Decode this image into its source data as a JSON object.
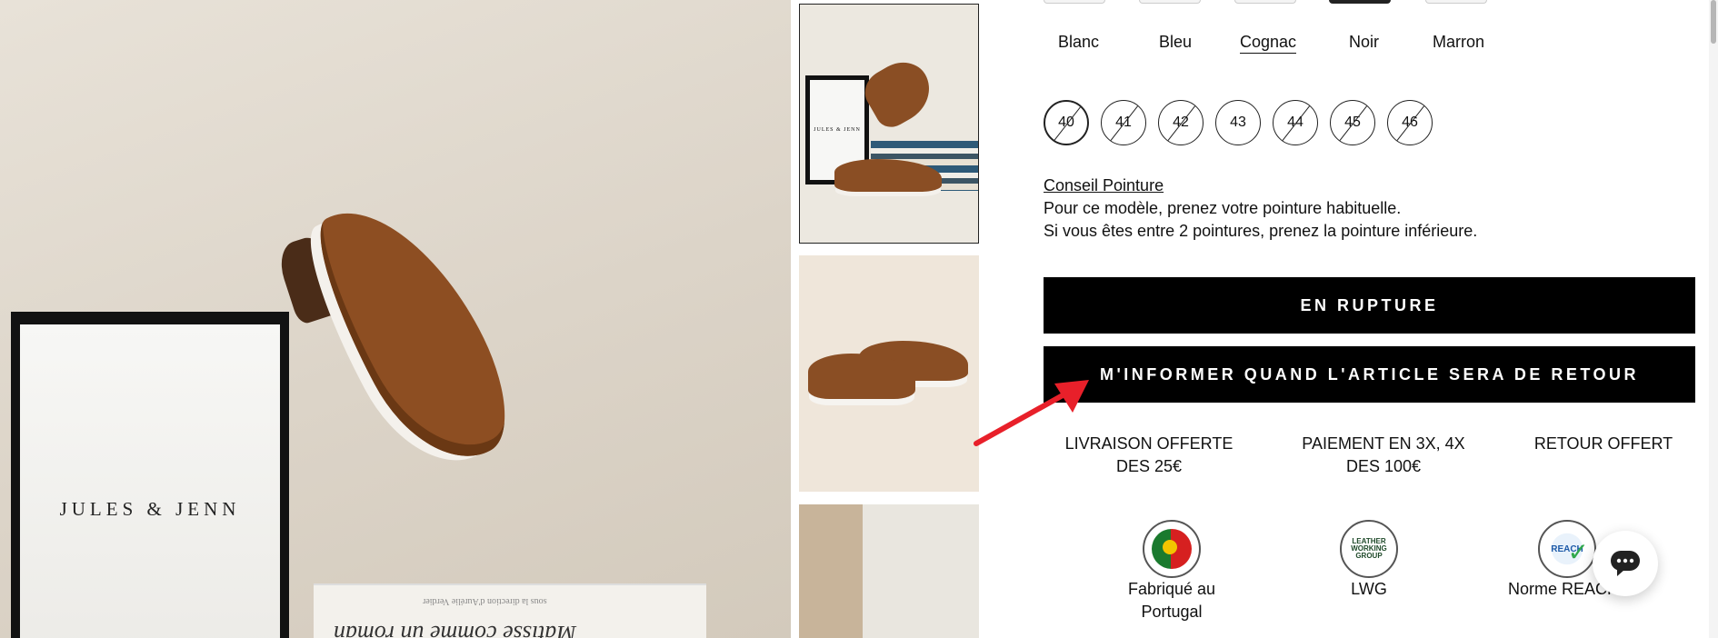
{
  "gallery": {
    "box_brand": "JULES & JENN",
    "book_title": "Matisse comme un roman",
    "book_subtitle": "sous la direction d'Aurélie Verdier",
    "thumb_box_brand": "JULES & JENN"
  },
  "colors": {
    "options": [
      {
        "label": "Blanc",
        "active": false
      },
      {
        "label": "Bleu",
        "active": false
      },
      {
        "label": "Cognac",
        "active": true
      },
      {
        "label": "Noir",
        "active": false
      },
      {
        "label": "Marron",
        "active": false
      }
    ]
  },
  "sizes": {
    "options": [
      {
        "label": "40",
        "available": false,
        "selected": true
      },
      {
        "label": "41",
        "available": false,
        "selected": false
      },
      {
        "label": "42",
        "available": false,
        "selected": false
      },
      {
        "label": "43",
        "available": true,
        "selected": false
      },
      {
        "label": "44",
        "available": false,
        "selected": false
      },
      {
        "label": "45",
        "available": false,
        "selected": false
      },
      {
        "label": "46",
        "available": false,
        "selected": false
      }
    ]
  },
  "sizing_advice": {
    "title": "Conseil Pointure",
    "line1": "Pour ce modèle, prenez votre pointure habituelle.",
    "line2": "Si vous êtes entre 2 pointures, prenez la pointure inférieure."
  },
  "buttons": {
    "out_of_stock": "EN RUPTURE",
    "notify": "M'INFORMER QUAND L'ARTICLE SERA DE RETOUR"
  },
  "perks": {
    "delivery_line1": "LIVRAISON OFFERTE",
    "delivery_line2": "DES 25€",
    "payment_line1": "PAIEMENT EN 3X, 4X",
    "payment_line2": "DES 100€",
    "returns": "RETOUR OFFERT"
  },
  "badges": {
    "portugal_line1": "Fabriqué au",
    "portugal_line2": "Portugal",
    "lwg": "LWG",
    "lwg_logo_text": "LEATHER WORKING GROUP",
    "reach": "Norme REACH",
    "reach_logo_text": "REACH"
  },
  "chat": {
    "icon": "chat-bubble-icon"
  },
  "theme": {
    "arrow_color": "#e8202a",
    "button_bg": "#000000"
  }
}
